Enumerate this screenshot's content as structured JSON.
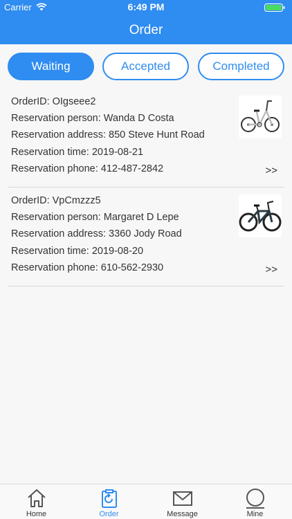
{
  "status_bar": {
    "carrier": "Carrier",
    "time": "6:49 PM"
  },
  "nav": {
    "title": "Order"
  },
  "tabs": [
    {
      "label": "Waiting",
      "active": true
    },
    {
      "label": "Accepted",
      "active": false
    },
    {
      "label": "Completed",
      "active": false
    }
  ],
  "orders": [
    {
      "order_id": "OrderID: OIgseee2",
      "person": "Reservation person: Wanda D Costa",
      "address": "Reservation address: 850 Steve Hunt Road",
      "time": "Reservation time: 2019-08-21",
      "phone": "Reservation phone: 412-487-2842",
      "more": ">>",
      "image": "folding-bike-icon"
    },
    {
      "order_id": "OrderID: VpCmzzz5",
      "person": "Reservation person: Margaret D Lepe",
      "address": "Reservation address: 3360 Jody Road",
      "time": "Reservation time: 2019-08-20",
      "phone": "Reservation phone: 610-562-2930",
      "more": ">>",
      "image": "mountain-bike-icon"
    }
  ],
  "tabbar": [
    {
      "label": "Home",
      "icon": "home-icon",
      "active": false
    },
    {
      "label": "Order",
      "icon": "order-icon",
      "active": true
    },
    {
      "label": "Message",
      "icon": "message-icon",
      "active": false
    },
    {
      "label": "Mine",
      "icon": "user-icon",
      "active": false
    }
  ],
  "colors": {
    "accent": "#2f8cf0",
    "background": "#f7f7f7",
    "text": "#333333",
    "battery": "#4cd964"
  }
}
